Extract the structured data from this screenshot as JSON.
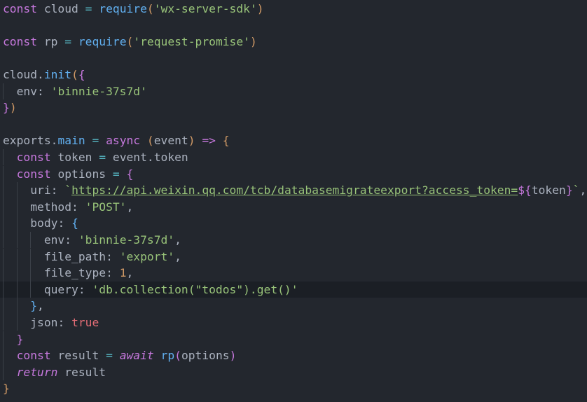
{
  "editor": {
    "theme": {
      "background": "#23272e",
      "active_line_background": "#1b1f25",
      "keyword": "#c678dd",
      "function": "#61afef",
      "string": "#98c379",
      "number": "#d19a66",
      "boolean": "#e06c75",
      "operator": "#56b6c2",
      "default": "#abb2bf"
    },
    "lines": [
      [
        [
          "keyword",
          "const"
        ],
        [
          "ws",
          " "
        ],
        [
          "ident",
          "cloud"
        ],
        [
          "ws",
          " "
        ],
        [
          "op",
          "="
        ],
        [
          "ws",
          " "
        ],
        [
          "func",
          "require"
        ],
        [
          "bracket-1",
          "("
        ],
        [
          "string",
          "'wx-server-sdk'"
        ],
        [
          "bracket-1",
          ")"
        ]
      ],
      [],
      [
        [
          "keyword",
          "const"
        ],
        [
          "ws",
          " "
        ],
        [
          "ident",
          "rp"
        ],
        [
          "ws",
          " "
        ],
        [
          "op",
          "="
        ],
        [
          "ws",
          " "
        ],
        [
          "func",
          "require"
        ],
        [
          "bracket-1",
          "("
        ],
        [
          "string",
          "'request-promise'"
        ],
        [
          "bracket-1",
          ")"
        ]
      ],
      [],
      [
        [
          "ident",
          "cloud"
        ],
        [
          "punct",
          "."
        ],
        [
          "func",
          "init"
        ],
        [
          "bracket-1",
          "("
        ],
        [
          "bracket-2",
          "{"
        ]
      ],
      [
        [
          "ws",
          "  "
        ],
        [
          "prop",
          "env"
        ],
        [
          "punct",
          ":"
        ],
        [
          "ws",
          " "
        ],
        [
          "string",
          "'binnie-37s7d'"
        ]
      ],
      [
        [
          "bracket-2",
          "}"
        ],
        [
          "bracket-1",
          ")"
        ]
      ],
      [],
      [
        [
          "ident",
          "exports"
        ],
        [
          "punct",
          "."
        ],
        [
          "func",
          "main"
        ],
        [
          "ws",
          " "
        ],
        [
          "op",
          "="
        ],
        [
          "ws",
          " "
        ],
        [
          "keyword",
          "async"
        ],
        [
          "ws",
          " "
        ],
        [
          "bracket-1",
          "("
        ],
        [
          "ident",
          "event"
        ],
        [
          "bracket-1",
          ")"
        ],
        [
          "ws",
          " "
        ],
        [
          "keyword",
          "=>"
        ],
        [
          "ws",
          " "
        ],
        [
          "bracket-1",
          "{"
        ]
      ],
      [
        [
          "ws",
          "  "
        ],
        [
          "keyword",
          "const"
        ],
        [
          "ws",
          " "
        ],
        [
          "ident",
          "token"
        ],
        [
          "ws",
          " "
        ],
        [
          "op",
          "="
        ],
        [
          "ws",
          " "
        ],
        [
          "ident",
          "event"
        ],
        [
          "punct",
          "."
        ],
        [
          "ident",
          "token"
        ]
      ],
      [
        [
          "ws",
          "  "
        ],
        [
          "keyword",
          "const"
        ],
        [
          "ws",
          " "
        ],
        [
          "ident",
          "options"
        ],
        [
          "ws",
          " "
        ],
        [
          "op",
          "="
        ],
        [
          "ws",
          " "
        ],
        [
          "bracket-2",
          "{"
        ]
      ],
      [
        [
          "ws",
          "    "
        ],
        [
          "prop",
          "uri"
        ],
        [
          "punct",
          ":"
        ],
        [
          "ws",
          " "
        ],
        [
          "string",
          "`"
        ],
        [
          "url",
          "https://api.weixin.qq.com/tcb/databasemigrateexport?access_token="
        ],
        [
          "interp",
          "${"
        ],
        [
          "ident",
          "token"
        ],
        [
          "interp",
          "}"
        ],
        [
          "string",
          "`"
        ],
        [
          "punct",
          ","
        ]
      ],
      [
        [
          "ws",
          "    "
        ],
        [
          "prop",
          "method"
        ],
        [
          "punct",
          ":"
        ],
        [
          "ws",
          " "
        ],
        [
          "string",
          "'POST'"
        ],
        [
          "punct",
          ","
        ]
      ],
      [
        [
          "ws",
          "    "
        ],
        [
          "prop",
          "body"
        ],
        [
          "punct",
          ":"
        ],
        [
          "ws",
          " "
        ],
        [
          "bracket-3",
          "{"
        ]
      ],
      [
        [
          "ws",
          "      "
        ],
        [
          "prop",
          "env"
        ],
        [
          "punct",
          ":"
        ],
        [
          "ws",
          " "
        ],
        [
          "string",
          "'binnie-37s7d'"
        ],
        [
          "punct",
          ","
        ]
      ],
      [
        [
          "ws",
          "      "
        ],
        [
          "prop",
          "file_path"
        ],
        [
          "punct",
          ":"
        ],
        [
          "ws",
          " "
        ],
        [
          "string",
          "'export'"
        ],
        [
          "punct",
          ","
        ]
      ],
      [
        [
          "ws",
          "      "
        ],
        [
          "prop",
          "file_type"
        ],
        [
          "punct",
          ":"
        ],
        [
          "ws",
          " "
        ],
        [
          "number",
          "1"
        ],
        [
          "punct",
          ","
        ]
      ],
      [
        [
          "ws",
          "      "
        ],
        [
          "prop",
          "query"
        ],
        [
          "punct",
          ":"
        ],
        [
          "ws",
          " "
        ],
        [
          "string",
          "'db.collection(\"todos\").get()'"
        ]
      ],
      [
        [
          "ws",
          "    "
        ],
        [
          "bracket-3",
          "}"
        ],
        [
          "punct",
          ","
        ]
      ],
      [
        [
          "ws",
          "    "
        ],
        [
          "prop",
          "json"
        ],
        [
          "punct",
          ":"
        ],
        [
          "ws",
          " "
        ],
        [
          "bool",
          "true"
        ]
      ],
      [
        [
          "ws",
          "  "
        ],
        [
          "bracket-2",
          "}"
        ]
      ],
      [
        [
          "ws",
          "  "
        ],
        [
          "keyword",
          "const"
        ],
        [
          "ws",
          " "
        ],
        [
          "ident",
          "result"
        ],
        [
          "ws",
          " "
        ],
        [
          "op",
          "="
        ],
        [
          "ws",
          " "
        ],
        [
          "keyword-italic",
          "await"
        ],
        [
          "ws",
          " "
        ],
        [
          "func",
          "rp"
        ],
        [
          "bracket-2",
          "("
        ],
        [
          "ident",
          "options"
        ],
        [
          "bracket-2",
          ")"
        ]
      ],
      [
        [
          "ws",
          "  "
        ],
        [
          "keyword-italic",
          "return"
        ],
        [
          "ws",
          " "
        ],
        [
          "ident",
          "result"
        ]
      ],
      [
        [
          "bracket-1",
          "}"
        ]
      ]
    ],
    "active_line_index": 17
  }
}
